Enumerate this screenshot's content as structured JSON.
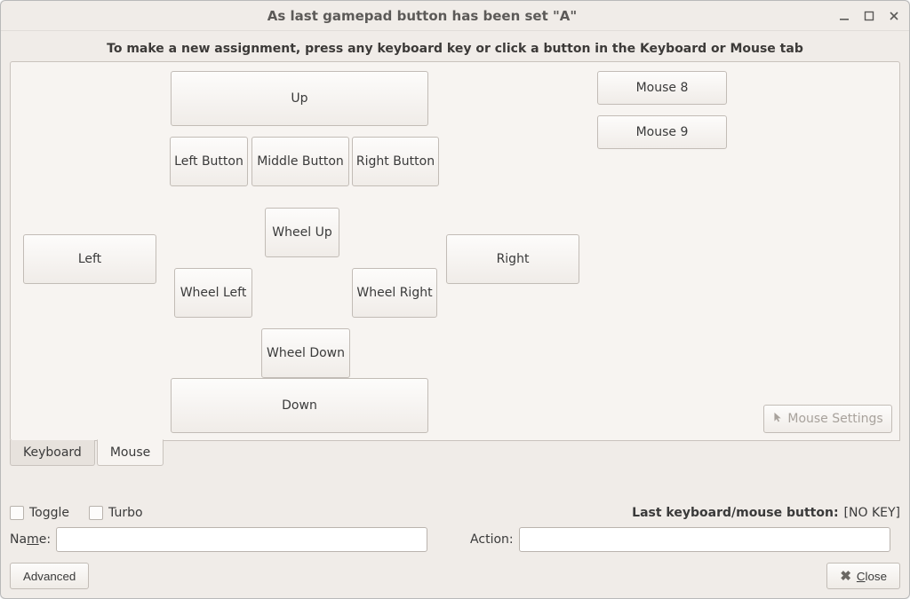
{
  "window": {
    "title": "As last gamepad button has been set \"A\""
  },
  "instruction": "To make a new assignment, press any keyboard key or click a button in the Keyboard or Mouse tab",
  "tabs": {
    "keyboard": "Keyboard",
    "mouse": "Mouse",
    "active": "mouse"
  },
  "mouse_buttons": {
    "up": "Up",
    "down": "Down",
    "left": "Left",
    "right": "Right",
    "left_button": "Left Button",
    "middle_button": "Middle Button",
    "right_button": "Right Button",
    "wheel_up": "Wheel Up",
    "wheel_down": "Wheel Down",
    "wheel_left": "Wheel Left",
    "wheel_right": "Wheel Right",
    "mouse_8": "Mouse 8",
    "mouse_9": "Mouse 9"
  },
  "mouse_settings_label": "Mouse Settings",
  "checkboxes": {
    "toggle": "Toggle",
    "turbo": "Turbo"
  },
  "last_button": {
    "label": "Last keyboard/mouse button:",
    "value": "[NO KEY]"
  },
  "fields": {
    "name_label_pre": "Na",
    "name_label_u": "m",
    "name_label_post": "e:",
    "action_label": "Action:",
    "name_value": "",
    "action_value": ""
  },
  "buttons": {
    "advanced": "Advanced",
    "close_pre": "",
    "close_u": "C",
    "close_post": "lose"
  }
}
